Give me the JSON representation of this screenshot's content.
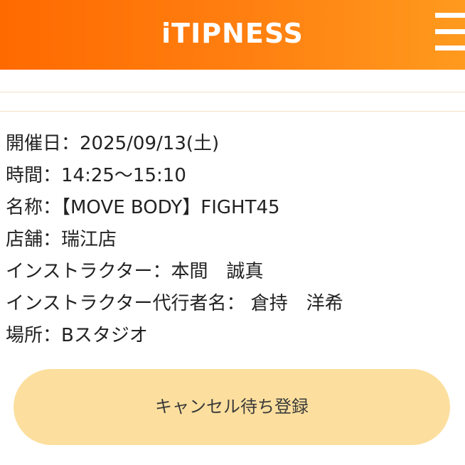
{
  "header": {
    "logo_text": "iTIPNESS",
    "menu_icon": "hamburger-menu-icon",
    "background_colors": [
      "#ff6a00",
      "#ff9a1e"
    ]
  },
  "lesson": {
    "date": "開催日：2025/09/13(土)",
    "time": "時間：14:25〜15:10",
    "name": "名称：【MOVE BODY】FIGHT45",
    "store": "店舗：瑞江店",
    "instructor": "インストラクター：本間　誠真",
    "substitute_instructor": "インストラクター代行者名： 倉持　洋希",
    "location": "場所：Bスタジオ"
  },
  "actions": {
    "waitlist_label": "キャンセル待ち登録",
    "button_color": "#fcdf9e"
  }
}
